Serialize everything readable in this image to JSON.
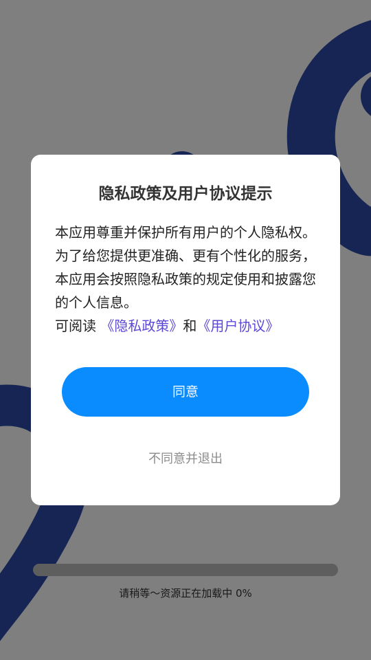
{
  "dialog": {
    "title": "隐私政策及用户协议提示",
    "body_text": "本应用尊重并保护所有用户的个人隐私权。为了给您提供更准确、更有个性化的服务， 本应用会按照隐私政策的规定使用和披露您的个人信息。",
    "read_prefix": "可阅读 ",
    "privacy_link": "《隐私政策》",
    "conjunction": "和",
    "agreement_link": "《用户协议》",
    "agree_label": "同意",
    "decline_label": "不同意并退出"
  },
  "loading": {
    "text": "请稍等～资源正在加载中 0%",
    "progress": 0
  },
  "colors": {
    "primary_button": "#0a8cff",
    "link": "#5b48d6",
    "overlay": "rgba(0,0,0,0.5)",
    "decoration": "#2d4aa8"
  }
}
